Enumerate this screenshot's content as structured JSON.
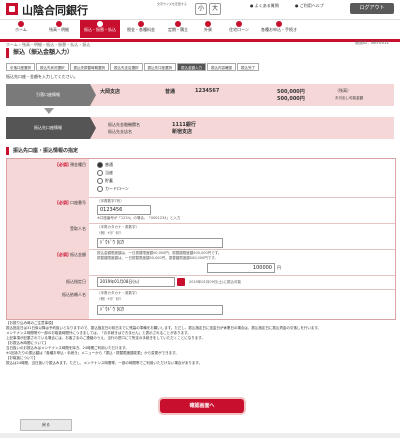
{
  "header": {
    "bank_name": "山陰合同銀行",
    "font_size_label": "文字サイズを変更する",
    "size_small": "小",
    "size_large": "大",
    "link_faq": "よくある質問",
    "link_help": "ご利用ヘルプ",
    "logout": "ログアウト"
  },
  "nav": {
    "items": [
      {
        "label": "ホーム"
      },
      {
        "label": "残高・明細"
      },
      {
        "label": "振込・振替・払込"
      },
      {
        "label": "税金・各種料金"
      },
      {
        "label": "定期・積立"
      },
      {
        "label": "外貨"
      },
      {
        "label": "住宅ローン"
      },
      {
        "label": "各種お申込・手続き"
      }
    ]
  },
  "breadcrumb": "ホーム › 残高・明細 › 振込・振替・払込 › 振込",
  "screen_id": "画面ID：BKF0012",
  "page_title": "振込（振込金額入力）",
  "steps": [
    "引落口座選択",
    "振込先状況選択",
    "振込先振替時期選択",
    "振込先支店選択",
    "振込先口座選択",
    "振込金額入力",
    "振込内容確認",
    "振込完了"
  ],
  "current_step_index": 5,
  "instruction": "振込先口座・金額を入力してください。",
  "source": {
    "head": "引落口座情報",
    "branch": "大岡支店",
    "type": "普通",
    "account": "1234567",
    "balance1": "500,000円",
    "balance1_note": "（残高）",
    "balance2": "500,000円",
    "balance2_note": "お引出し可能金額"
  },
  "destination": {
    "head": "振込先口座情報",
    "bank_label": "振込先金融機関名",
    "bank_value": "1111銀行",
    "branch_label": "振込先支店名",
    "branch_value": "新宿支店"
  },
  "form": {
    "section_title": "振込先口座・振込情報の指定",
    "required": "[必須]",
    "deposit_type": {
      "label": "預金種目",
      "options": [
        "普通",
        "当座",
        "貯蓄",
        "カードローン"
      ],
      "selected": 0
    },
    "account_number": {
      "label": "口座番号",
      "hint": "（半角数字7桁）",
      "value": "0123456",
      "note": "※口座番号が「1234」の場合、「0001234」と入力"
    },
    "recipient_name": {
      "label": "受取人名",
      "hint": "（半角カタカナ・英数字）",
      "example": "（例）ﾔﾏﾀﾞ ﾀﾛｳ",
      "value": "ﾄﾞｳﾄﾞｳ ﾀﾛｳ"
    },
    "amount": {
      "label": "振込金額",
      "note1": "振込金額限度額は、一日振替限度額50,000円、振替額限度額500,000円です。",
      "note2": "振替額限度額は、一日振替限度額50,000円、振替額限度額500,000円です。",
      "value": "100000",
      "unit": "円"
    },
    "date": {
      "label": "振込指定日",
      "value": "2019年01月08日(火)",
      "note": "2019年01月09日(土)に振込可能"
    },
    "requester": {
      "label": "振込依頼人名",
      "hint": "（半角カタカナ・英数字）",
      "example": "（例）ﾔﾏﾀﾞ ﾀﾛｳ",
      "value": "ﾄﾞｳﾄﾞｳ ﾀﾛｳ"
    }
  },
  "notes": [
    "【お振り込み時のご注意事項】",
    "振込指定日は31日後以降は予約扱いとなりますので、振込指定日の前日までに残高の準備をお願いします。ただし、振込指定日に送金日が休業日の場合は、振込指定日に振込資金の引落しを行います。",
    "メンテナンス時間帯や一部のお取扱時間外につきましては、「お手続きはできません」と表示されることがあります。",
    "上記事項が記載されている場合には、お客さまのご連絡のうえ、当行の窓口にて所定の手続きをしていただくことになります。",
    "【お振込み時間について】",
    "当日扱いのお振込みはメンテナンス時間を除き、24時間ご利用いただけます。",
    "※1回あたりの振込額は「各種お申込・手続き」メニューから「振込・振替限度額変更」から変更ができます。",
    "【お取扱について】",
    "振込は24時間、当日扱いで振込みます。ただし、メンテナンス時間帯、一部の時間帯でご利用いただけない場合があります。"
  ],
  "buttons": {
    "confirm": "確認画面へ",
    "back": "戻る"
  },
  "colors": {
    "brand": "#c8102e",
    "panel": "#f5d7d7"
  }
}
